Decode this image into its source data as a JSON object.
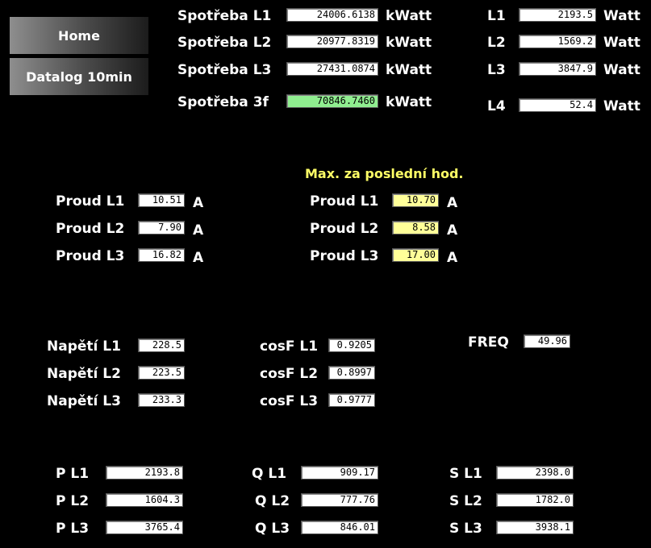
{
  "nav": {
    "home": "Home",
    "datalog": "Datalog 10min"
  },
  "units": {
    "kwatt": "kWatt",
    "watt": "Watt",
    "amp": "A"
  },
  "consumption": [
    {
      "label": "Spotřeba L1",
      "value": "24006.6138"
    },
    {
      "label": "Spotřeba L2",
      "value": "20977.8319"
    },
    {
      "label": "Spotřeba L3",
      "value": "27431.0874"
    },
    {
      "label": "Spotřeba 3f",
      "value": "70846.7460"
    }
  ],
  "power_now": [
    {
      "label": "L1",
      "value": "2193.5"
    },
    {
      "label": "L2",
      "value": "1569.2"
    },
    {
      "label": "L3",
      "value": "3847.9"
    },
    {
      "label": "L4",
      "value": "52.4"
    }
  ],
  "max_title": "Max. za poslední hod.",
  "current": [
    {
      "label": "Proud L1",
      "value": "10.51"
    },
    {
      "label": "Proud L2",
      "value": "7.90"
    },
    {
      "label": "Proud L3",
      "value": "16.82"
    }
  ],
  "current_max": [
    {
      "label": "Proud L1",
      "value": "10.70"
    },
    {
      "label": "Proud L2",
      "value": "8.58"
    },
    {
      "label": "Proud L3",
      "value": "17.00"
    }
  ],
  "voltage": [
    {
      "label": "Napětí L1",
      "value": "228.5"
    },
    {
      "label": "Napětí L2",
      "value": "223.5"
    },
    {
      "label": "Napětí L3",
      "value": "233.3"
    }
  ],
  "cosf": [
    {
      "label": "cosF L1",
      "value": "0.9205"
    },
    {
      "label": "cosF L2",
      "value": "0.8997"
    },
    {
      "label": "cosF L3",
      "value": "0.9777"
    }
  ],
  "freq": {
    "label": "FREQ",
    "value": "49.96"
  },
  "p": [
    {
      "label": "P L1",
      "value": "2193.8"
    },
    {
      "label": "P L2",
      "value": "1604.3"
    },
    {
      "label": "P L3",
      "value": "3765.4"
    }
  ],
  "q": [
    {
      "label": "Q L1",
      "value": "909.17"
    },
    {
      "label": "Q L2",
      "value": "777.76"
    },
    {
      "label": "Q L3",
      "value": "846.01"
    }
  ],
  "s": [
    {
      "label": "S L1",
      "value": "2398.0"
    },
    {
      "label": "S L2",
      "value": "1782.0"
    },
    {
      "label": "S L3",
      "value": "3938.1"
    }
  ]
}
